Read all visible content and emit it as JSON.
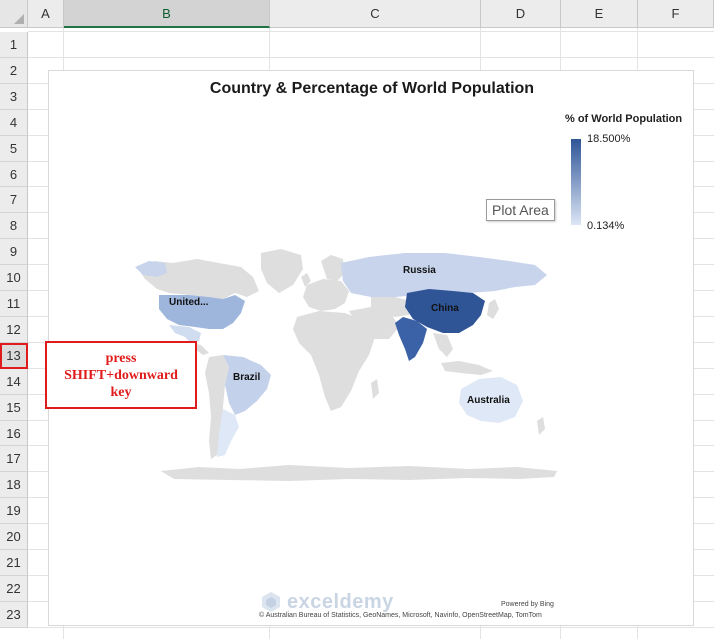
{
  "columns": [
    "A",
    "B",
    "C",
    "D",
    "E",
    "F"
  ],
  "selected_column": "B",
  "rows": [
    "1",
    "2",
    "3",
    "4",
    "5",
    "6",
    "7",
    "8",
    "9",
    "10",
    "11",
    "12",
    "13",
    "14",
    "15",
    "16",
    "17",
    "18",
    "19",
    "20",
    "21",
    "22",
    "23"
  ],
  "highlighted_row": "13",
  "chart": {
    "title": "Country & Percentage of World Population",
    "legend_title": "% of World Population",
    "legend_max": "18.500%",
    "legend_min": "0.134%",
    "tooltip": "Plot Area",
    "labels": {
      "russia": "Russia",
      "united": "United...",
      "china": "China",
      "brazil": "Brazil",
      "australia": "Australia"
    },
    "watermark": "exceldemy",
    "powered_by": "Powered by Bing",
    "copyright": "© Australian Bureau of Statistics, GeoNames, Microsoft, Navinfo, OpenStreetMap, TomTom",
    "colors": {
      "china": "#2f5597",
      "india": "#3b62a6",
      "united": "#9fb6dc",
      "russia": "#c7d4ec",
      "brazil": "#c3d1ea",
      "australia": "#dfe8f6",
      "other": "#dedede"
    }
  },
  "callout": {
    "text": "press SHIFT+downward key"
  }
}
